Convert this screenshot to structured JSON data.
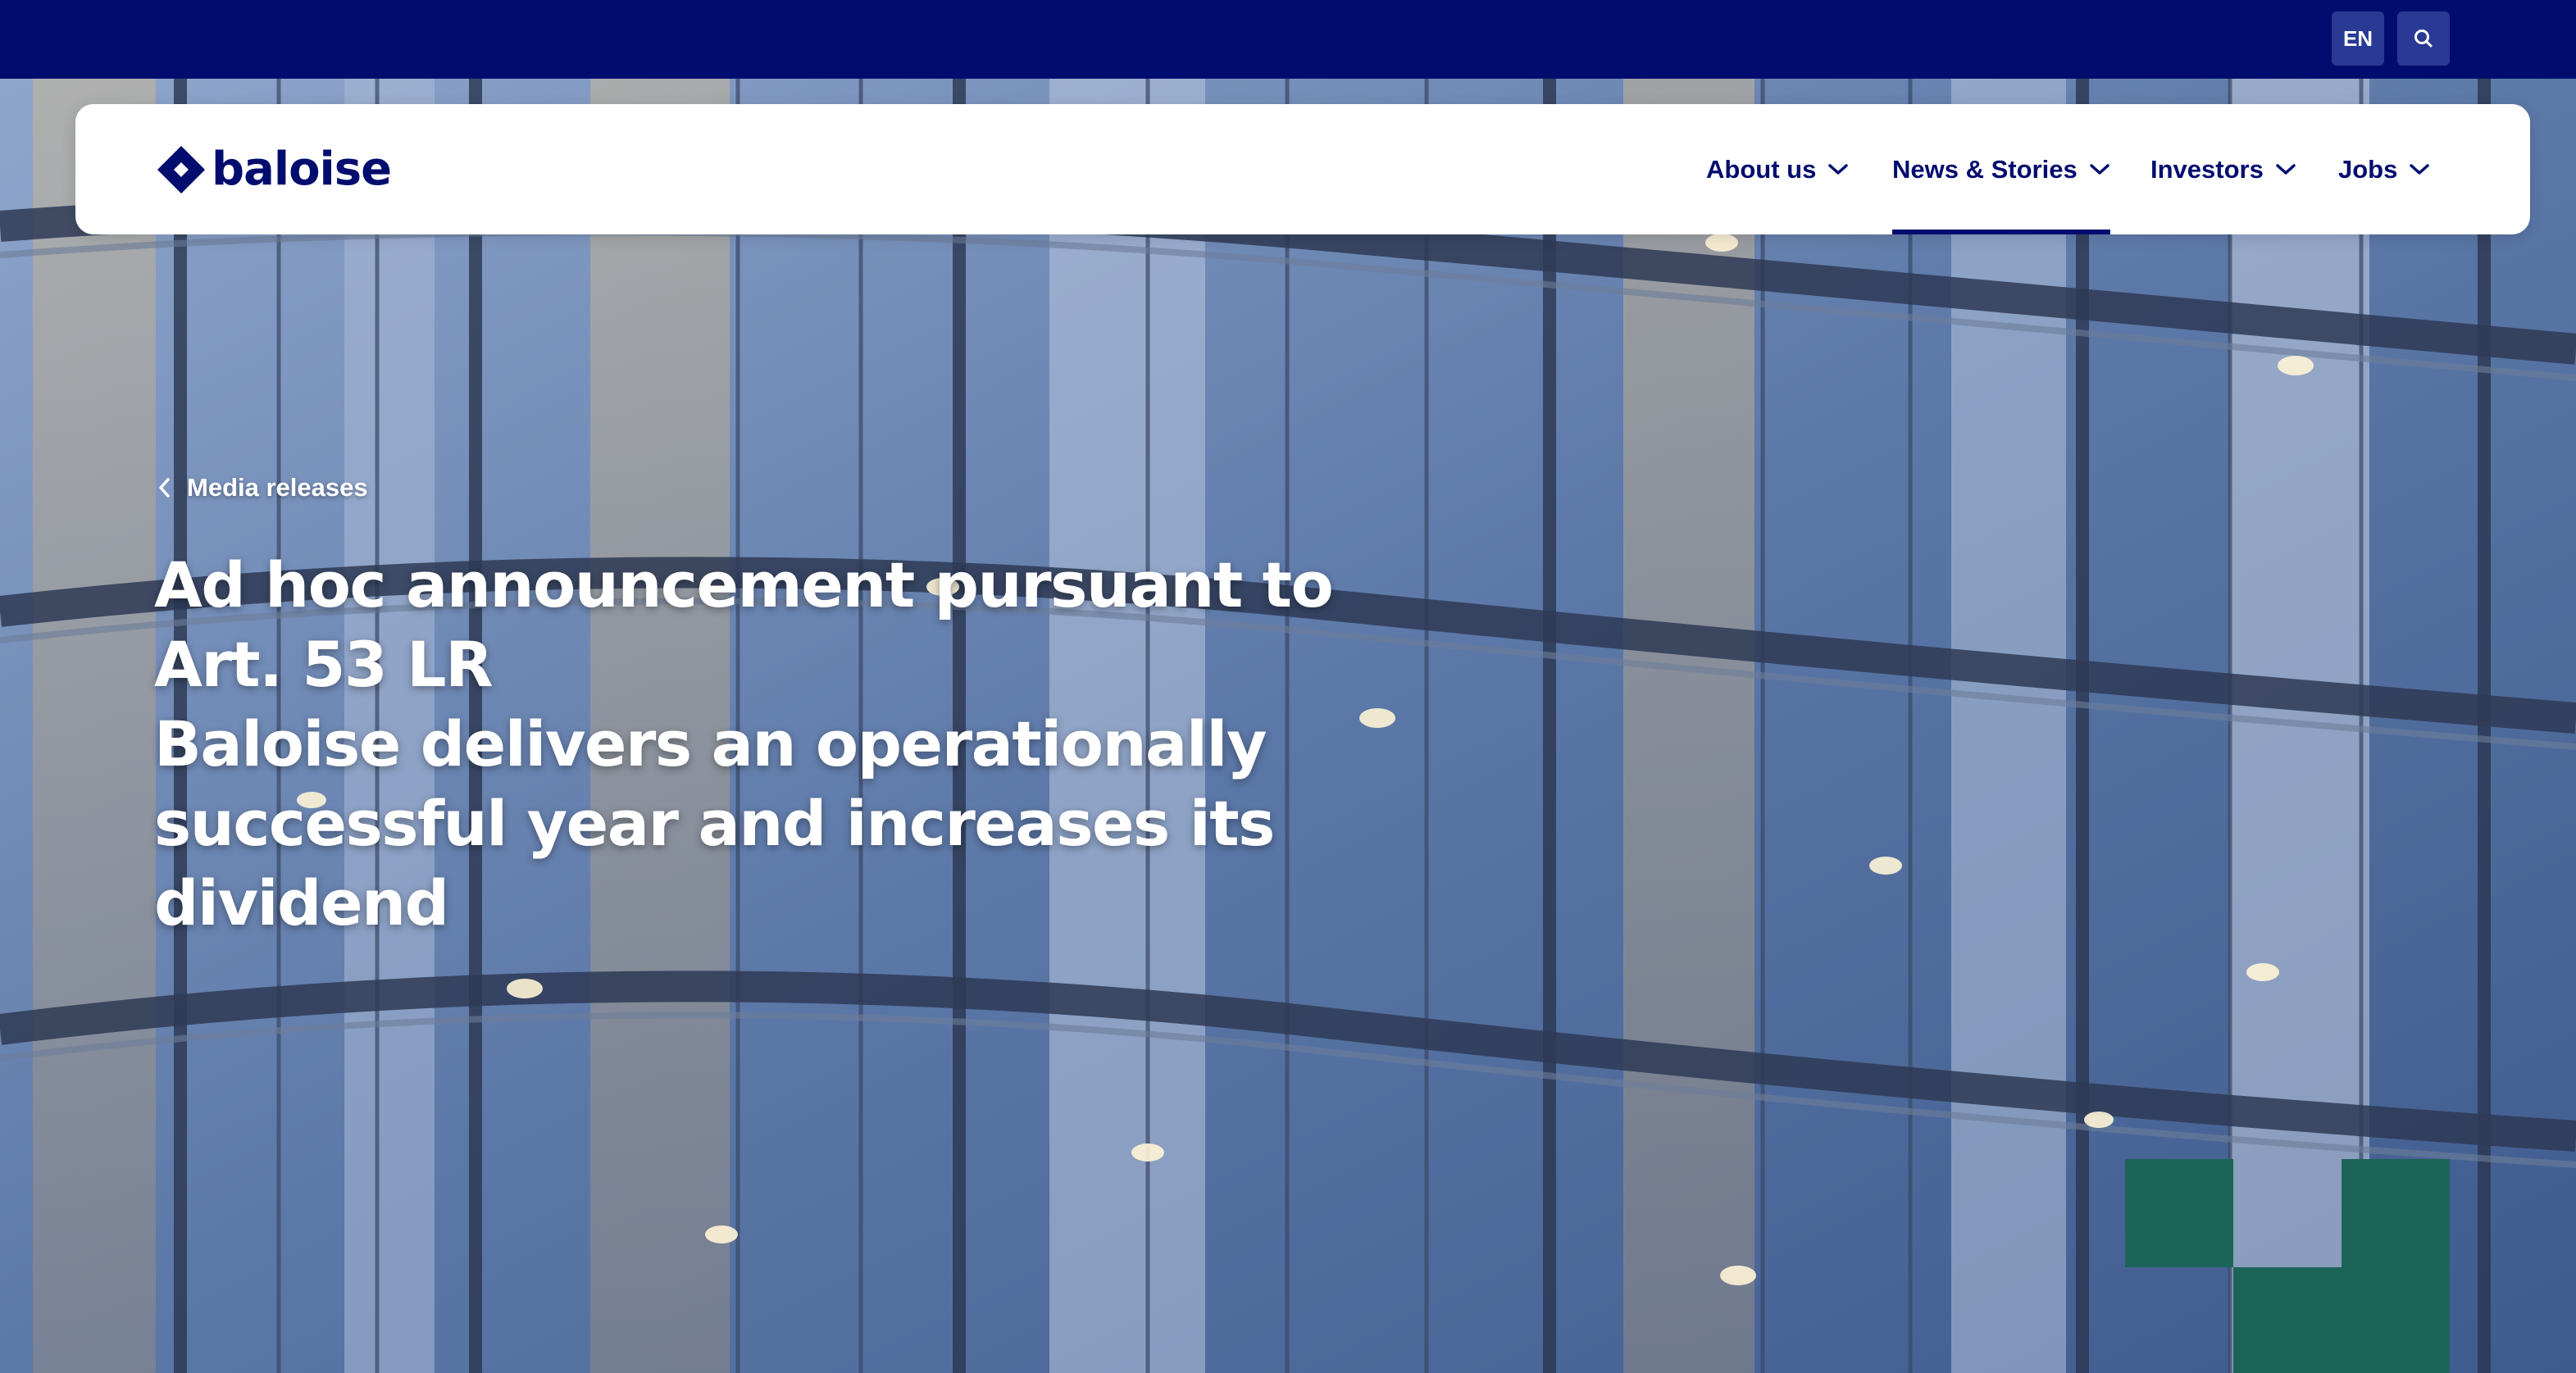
{
  "topbar": {
    "language_label": "EN",
    "search_icon": "search-icon"
  },
  "header": {
    "logo_text": "baloise",
    "nav": [
      {
        "label": "About us",
        "icon": "chevron-down-icon"
      },
      {
        "label": "News & Stories",
        "icon": "chevron-down-icon",
        "active": true
      },
      {
        "label": "Investors",
        "icon": "chevron-down-icon"
      },
      {
        "label": "Jobs",
        "icon": "chevron-down-icon"
      }
    ]
  },
  "hero": {
    "breadcrumb_label": "Media releases",
    "breadcrumb_icon": "chevron-left-icon",
    "title_lines": [
      "Ad hoc announcement pursuant to",
      "Art. 53 LR",
      "Baloise delivers an operationally",
      "successful year and increases its",
      "dividend"
    ]
  },
  "colors": {
    "brand_navy": "#000d6e",
    "accent_green": "#1c6458",
    "topbar_button": "#2a3a94"
  }
}
